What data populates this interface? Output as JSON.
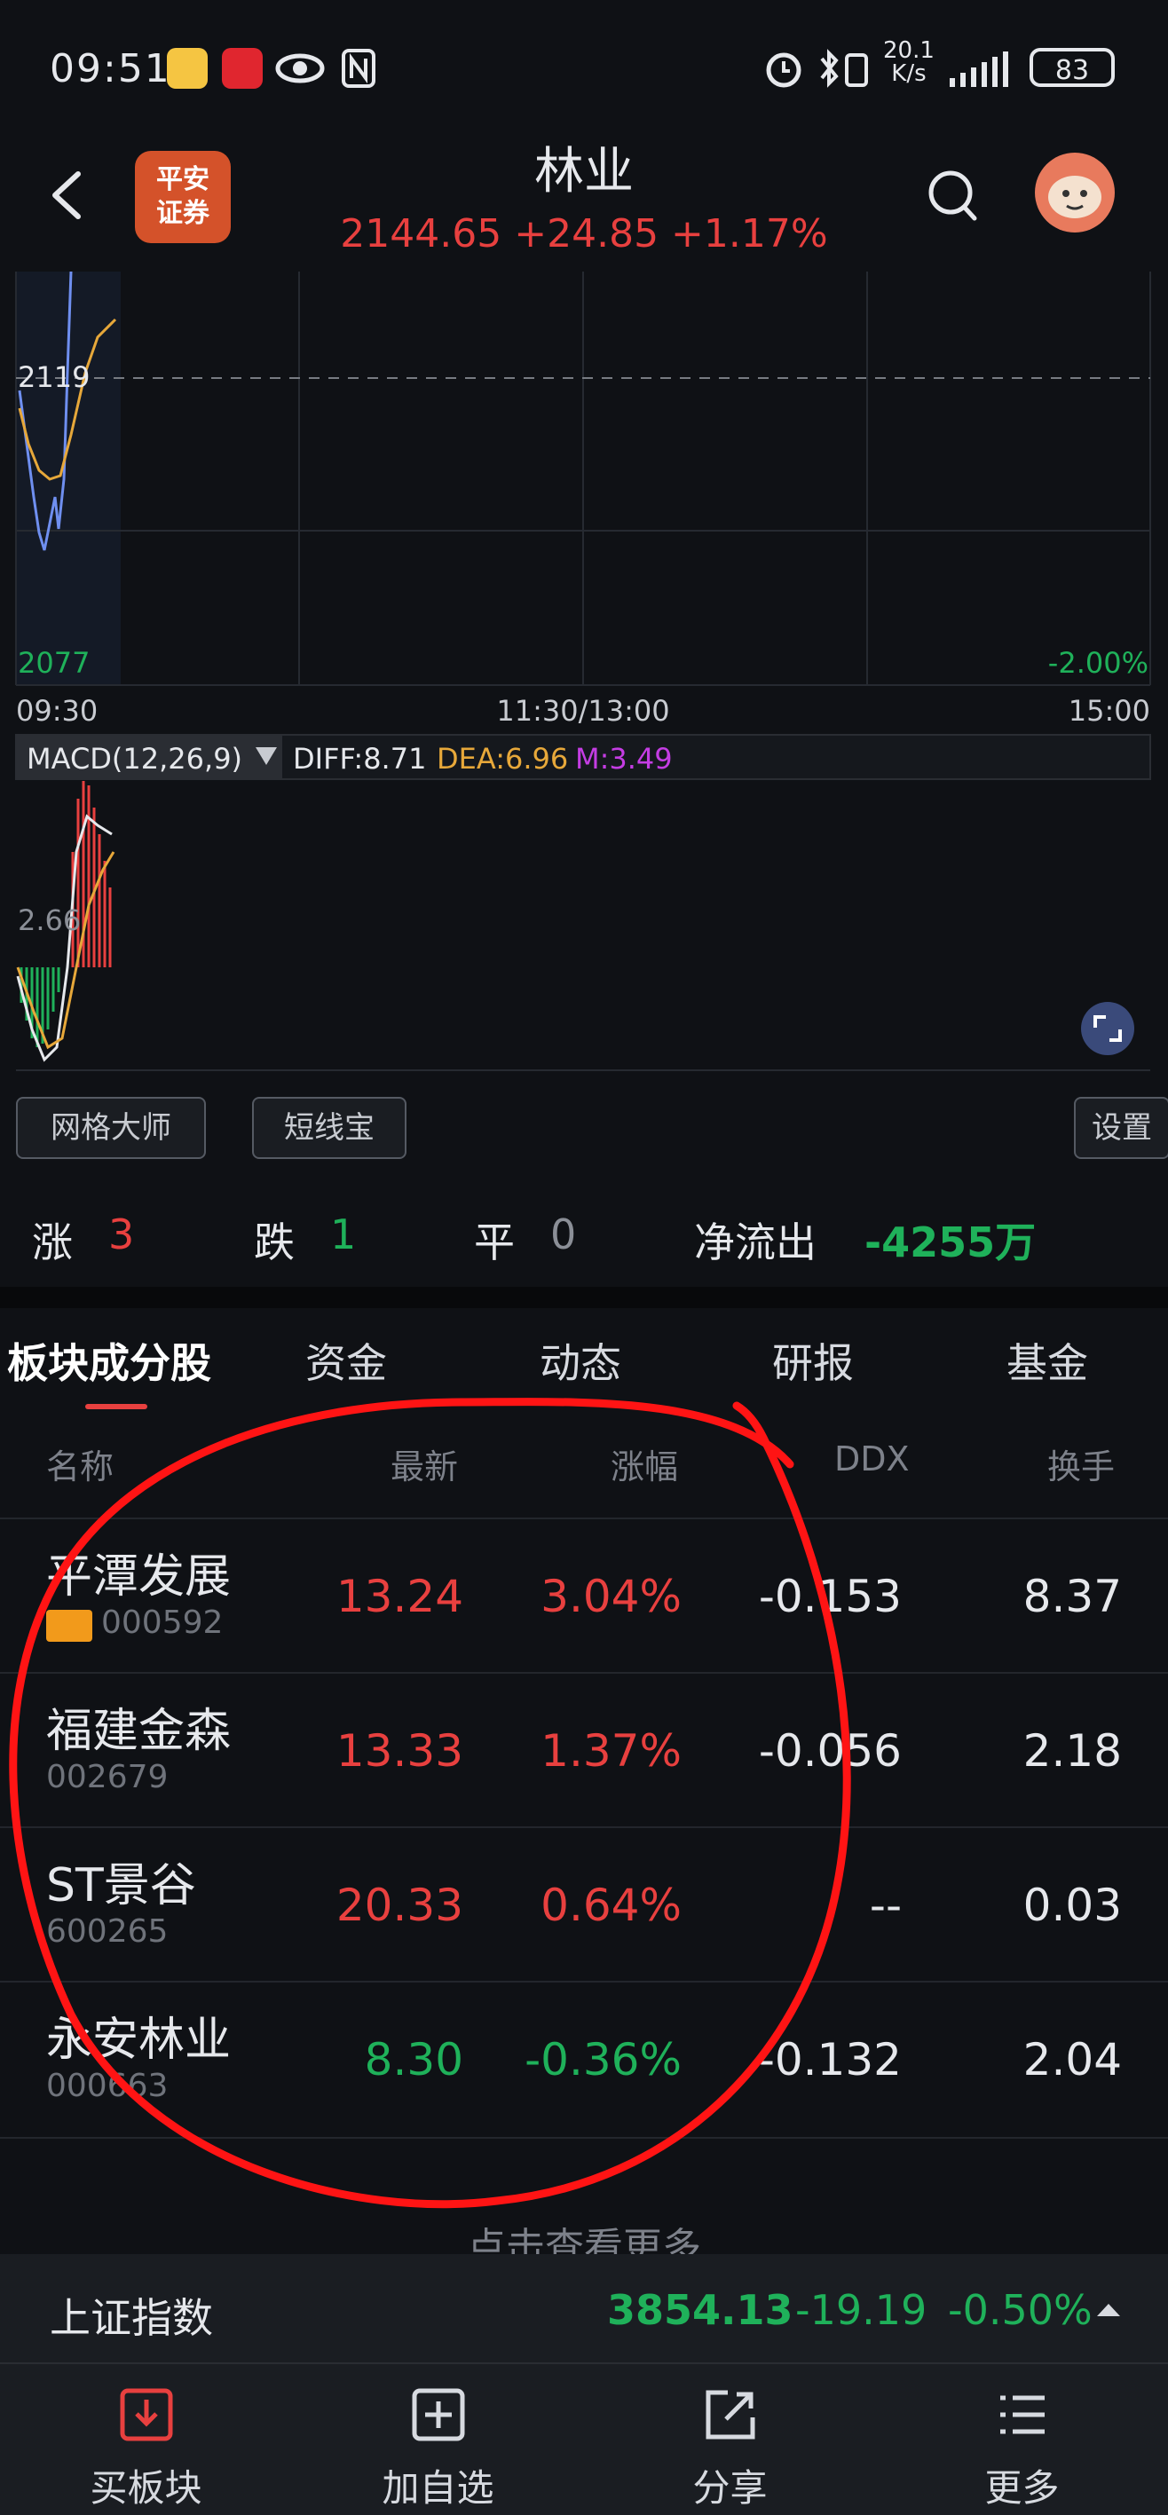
{
  "status_bar": {
    "time": "09:51",
    "net_speed_value": "20.1",
    "net_speed_unit": "K/s",
    "battery": "83"
  },
  "header": {
    "brand_logo_text": "平安证券",
    "title": "林业",
    "quote": "2144.65  +24.85  +1.17%"
  },
  "chart": {
    "y_high_label": "2119",
    "y_low_label": "2077",
    "y_low_pct": "-2.00%",
    "x_labels": [
      "09:30",
      "11:30/13:00",
      "15:00"
    ],
    "macd_label": "MACD(12,26,9)",
    "diff": "DIFF:8.71",
    "dea": "DEA:6.96",
    "m": "M:3.49",
    "macd_axis_label": "2.66",
    "colors": {
      "up": "#e8403f",
      "down": "#1fb15a",
      "price_line": "#6f8ff0",
      "avg_line": "#e7a83a",
      "dea": "#e7a83a",
      "m": "#c43de3"
    }
  },
  "tools": {
    "grid_button": "网格大师",
    "short_button": "短线宝",
    "settings_button": "设置"
  },
  "stats": {
    "up_label": "涨",
    "up_value": "3",
    "down_label": "跌",
    "down_value": "1",
    "flat_label": "平",
    "flat_value": "0",
    "net_label": "净流出",
    "net_value": "-4255万"
  },
  "tabs": [
    "板块成分股",
    "资金",
    "动态",
    "研报",
    "基金"
  ],
  "table": {
    "headers": [
      "名称",
      "最新",
      "涨幅",
      "DDX",
      "换手"
    ],
    "rows": [
      {
        "name": "平潭发展",
        "code": "000592",
        "price": "13.24",
        "change": "3.04%",
        "ddx": "-0.153",
        "turnover": "8.37",
        "dir": "up",
        "badge": true
      },
      {
        "name": "福建金森",
        "code": "002679",
        "price": "13.33",
        "change": "1.37%",
        "ddx": "-0.056",
        "turnover": "2.18",
        "dir": "up",
        "badge": false
      },
      {
        "name": "ST景谷",
        "code": "600265",
        "price": "20.33",
        "change": "0.64%",
        "ddx": "--",
        "turnover": "0.03",
        "dir": "up",
        "badge": false
      },
      {
        "name": "永安林业",
        "code": "000663",
        "price": "8.30",
        "change": "-0.36%",
        "ddx": "-0.132",
        "turnover": "2.04",
        "dir": "down",
        "badge": false
      }
    ],
    "more": "点击查看更多"
  },
  "index_bar": {
    "name": "上证指数",
    "price": "3854.13",
    "change": "-19.19",
    "pct": "-0.50%"
  },
  "bottom_nav": [
    "买板块",
    "加自选",
    "分享",
    "更多"
  ]
}
